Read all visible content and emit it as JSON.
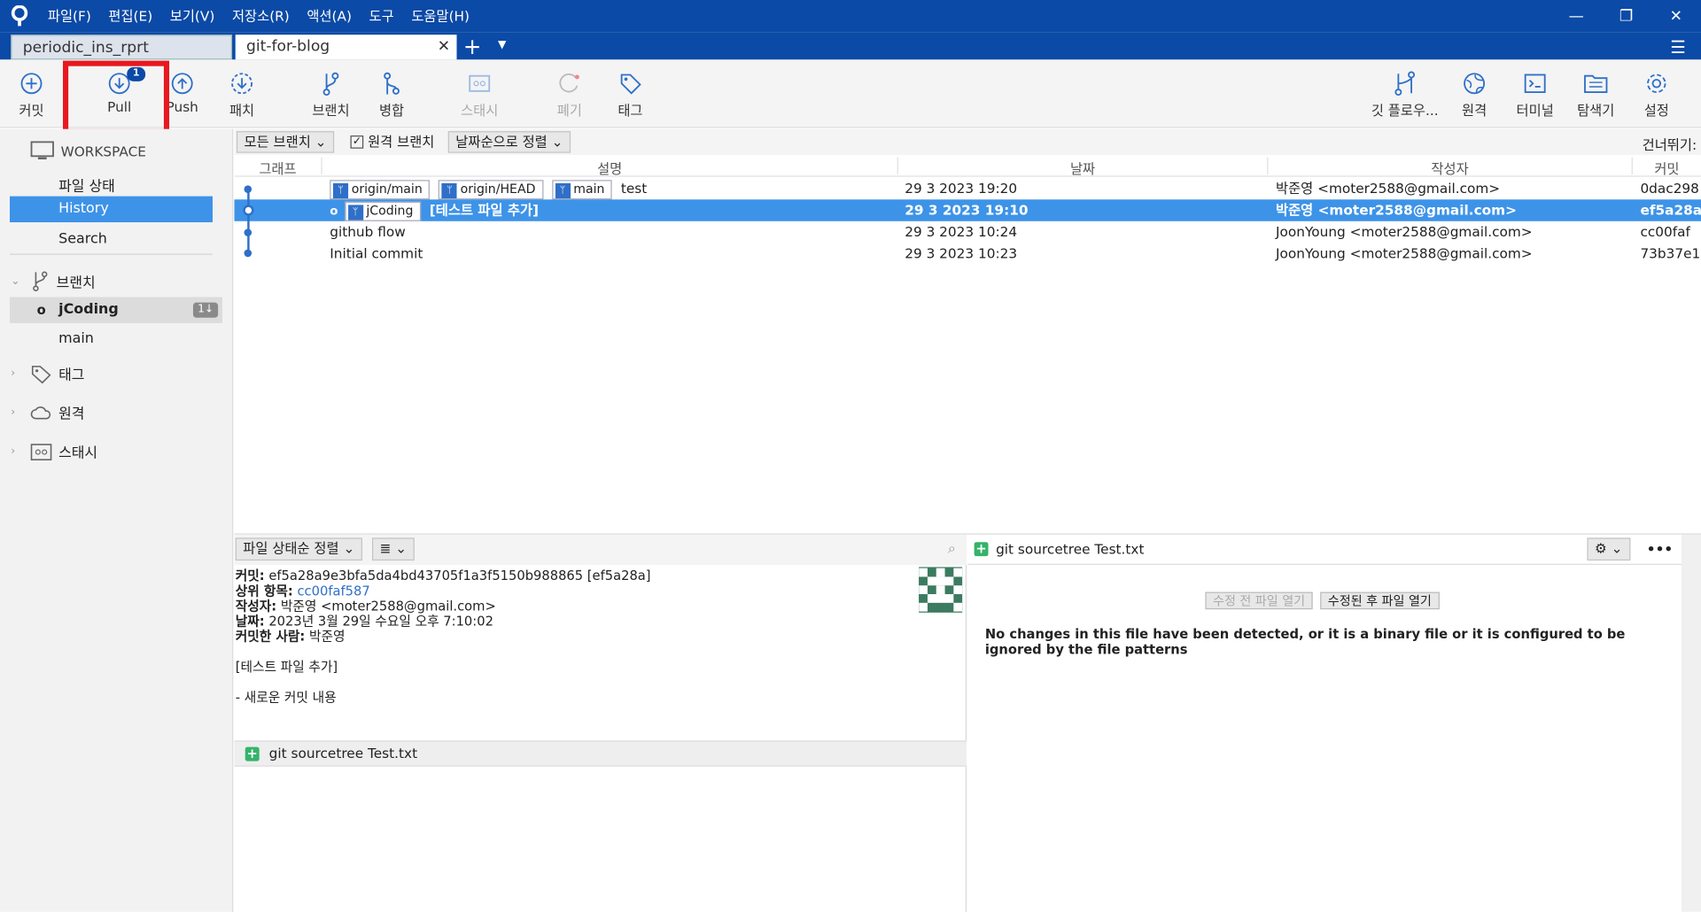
{
  "menu": [
    "파일(F)",
    "편집(E)",
    "보기(V)",
    "저장소(R)",
    "액션(A)",
    "도구",
    "도움말(H)"
  ],
  "window": {
    "min": "—",
    "restore": "❐",
    "close": "✕"
  },
  "tabs": [
    {
      "label": "periodic_ins_rprt"
    },
    {
      "label": "git-for-blog"
    }
  ],
  "toolbar": {
    "commit": "커밋",
    "pull": "Pull",
    "pull_badge": "1",
    "push": "Push",
    "patch": "패치",
    "branch": "브랜치",
    "merge": "병합",
    "stash": "스태시",
    "discard": "폐기",
    "tag": "태그",
    "gitflow": "깃 플로우...",
    "remote": "원격",
    "terminal": "터미널",
    "explorer": "탐색기",
    "settings": "설정"
  },
  "sidebar": {
    "workspace": "WORKSPACE",
    "file_status": "파일 상태",
    "history": "History",
    "search": "Search",
    "branches": "브랜치",
    "branch_items": [
      {
        "label": "jCoding",
        "badge": "1↓"
      },
      {
        "label": "main"
      }
    ],
    "tags": "태그",
    "remotes": "원격",
    "stashes": "스태시"
  },
  "filters": {
    "all_branches": "모든 브랜치",
    "remote_branches": "원격 브랜치",
    "sort": "날짜순으로 정렬",
    "skip": "건너뛰기:"
  },
  "columns": {
    "graph": "그래프",
    "desc": "설명",
    "date": "날짜",
    "author": "작성자",
    "commit": "커밋"
  },
  "commits": [
    {
      "tags": [
        "origin/main",
        "origin/HEAD",
        "main"
      ],
      "desc": "test",
      "date": "29 3 2023 19:20",
      "author": "박준영 <moter2588@gmail.com>",
      "hash": "0dac298"
    },
    {
      "tags": [
        "jCoding"
      ],
      "desc": "[테스트 파일 추가]",
      "date": "29 3 2023 19:10",
      "author": "박준영 <moter2588@gmail.com>",
      "hash": "ef5a28a"
    },
    {
      "tags": [],
      "desc": "github flow",
      "date": "29 3 2023 10:24",
      "author": "JoonYoung <moter2588@gmail.com>",
      "hash": "cc00faf"
    },
    {
      "tags": [],
      "desc": "Initial commit",
      "date": "29 3 2023 10:23",
      "author": "JoonYoung <moter2588@gmail.com>",
      "hash": "73b37e1"
    }
  ],
  "lower": {
    "sort_files": "파일 상태순 정렬",
    "list_icon": "≣",
    "commit_label": "커밋:",
    "commit_value": "ef5a28a9e3bfa5da4bd43705f1a3f5150b988865 [ef5a28a]",
    "parent_label": "상위 항목:",
    "parent_value": "cc00faf587",
    "author_label": "작성자:",
    "author_value": "박준영 <moter2588@gmail.com>",
    "date_label": "날짜:",
    "date_value": "2023년 3월 29일 수요일 오후 7:10:02",
    "committer_label": "커밋한 사람:",
    "committer_value": "박준영",
    "message_title": "[테스트 파일 추가]",
    "message_body": "- 새로운 커밋 내용",
    "file_name": "git sourcetree Test.txt"
  },
  "diff": {
    "file_name": "git sourcetree Test.txt",
    "open_before": "수정 전 파일 열기",
    "open_after": "수정된 후 파일 열기",
    "message": "No changes in this file have been detected, or it is a binary file or it is configured to be ignored by the file patterns",
    "more": "•••"
  },
  "colors": {
    "accent": "#0b4aa6",
    "selection": "#3d93e8",
    "highlight_box": "#e8181f"
  }
}
